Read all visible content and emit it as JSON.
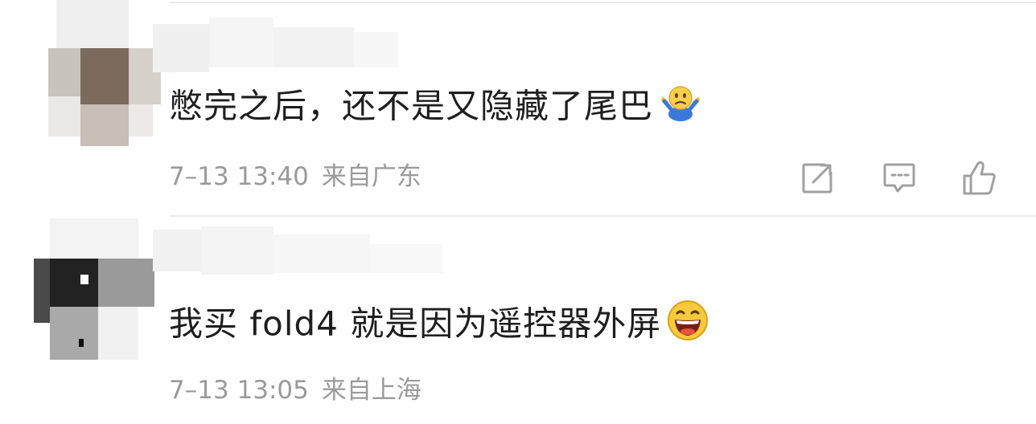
{
  "comments": [
    {
      "text": "憋完之后，还不是又隐藏了尾巴",
      "emoji": "shrug-emoji",
      "time": "7–13 13:40",
      "location": "来自广东",
      "actions": [
        "share-icon",
        "comment-icon",
        "like-icon"
      ]
    },
    {
      "text": "我买 fold4 就是因为遥控器外屏",
      "emoji": "laughing-emoji",
      "time": "7–13 13:05",
      "location": "来自上海"
    }
  ],
  "colors": {
    "text": "#1e1e1e",
    "meta": "#9a9a9a",
    "divider": "#ececec",
    "icon": "#a0a0a0"
  }
}
